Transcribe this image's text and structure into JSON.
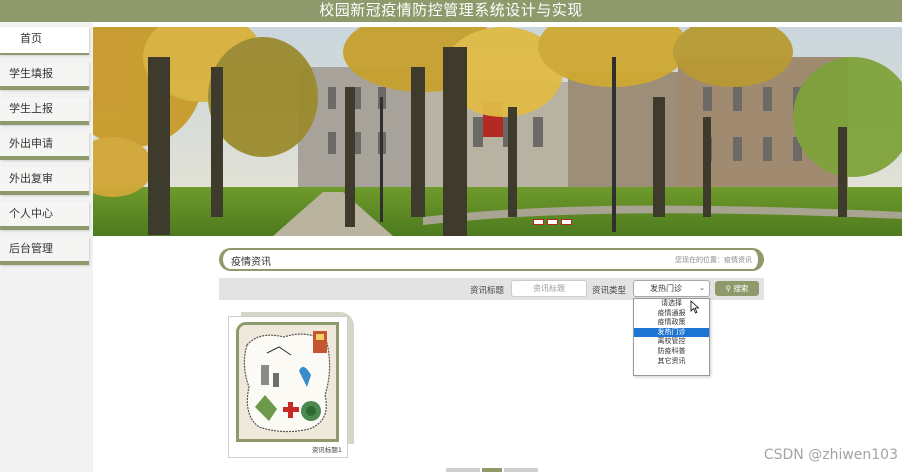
{
  "header": {
    "title": "校园新冠疫情防控管理系统设计与实现"
  },
  "sidebar": {
    "items": [
      {
        "label": "首页"
      },
      {
        "label": "学生填报"
      },
      {
        "label": "学生上报"
      },
      {
        "label": "外出申请"
      },
      {
        "label": "外出复审"
      },
      {
        "label": "个人中心"
      },
      {
        "label": "后台管理"
      }
    ]
  },
  "content": {
    "section_title": "疫情资讯",
    "breadcrumb": "您现在的位置：疫情资讯"
  },
  "search": {
    "title_label": "资讯标题",
    "title_placeholder": "资讯标题",
    "type_label": "资讯类型",
    "type_selected": "发热门诊",
    "button_label": "搜索",
    "options": [
      "请选择",
      "疫情通报",
      "疫情政策",
      "发热门诊",
      "离校管控",
      "防疫科普",
      "其它资讯"
    ],
    "selected_index": 3
  },
  "news": [
    {
      "caption": "资讯标题1"
    }
  ],
  "watermark": "CSDN @zhiwen103",
  "colors": {
    "accent": "#8f9a6c",
    "selected_option": "#1e74d2"
  }
}
